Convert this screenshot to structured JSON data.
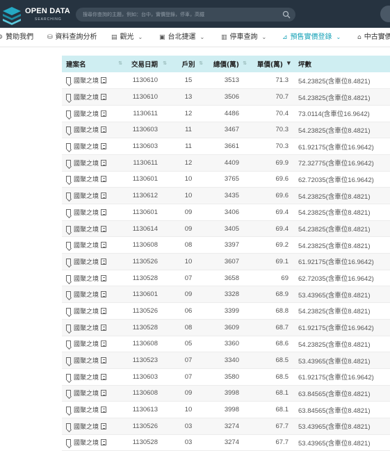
{
  "brand": {
    "line1": "OPEN DATA",
    "line2": "SEARCHING",
    "color": "#263340",
    "accent": "#1aa3b8"
  },
  "search": {
    "placeholder": "搜尋你查詢的主題，例如：台中，實價登錄，停車，高鐵",
    "icon": "search-icon"
  },
  "nav": [
    {
      "label": "贊助我們",
      "icon": "sponsor-icon",
      "dropdown": false
    },
    {
      "label": "資料查詢分析",
      "icon": "database-icon",
      "dropdown": false
    },
    {
      "label": "觀光",
      "icon": "tourism-icon",
      "dropdown": true
    },
    {
      "label": "台北捷運",
      "icon": "train-icon",
      "dropdown": true
    },
    {
      "label": "停車查詢",
      "icon": "parking-icon",
      "dropdown": true
    },
    {
      "label": "預售實價登錄",
      "icon": "presale-icon",
      "dropdown": true,
      "active": true
    },
    {
      "label": "中古實價",
      "icon": "house-icon",
      "dropdown": false
    }
  ],
  "table": {
    "headers": [
      "建案名",
      "交易日期",
      "戶別",
      "總價(萬)",
      "單價(萬)",
      "坪數"
    ],
    "sorted_column": "單價(萬)",
    "rows": [
      {
        "name": "國聚之境",
        "date": "1130610",
        "unit": "15",
        "total": "3513",
        "price": "71.3",
        "area": "54.23825(含車位8.4821)"
      },
      {
        "name": "國聚之境",
        "date": "1130610",
        "unit": "13",
        "total": "3506",
        "price": "70.7",
        "area": "54.23825(含車位8.4821)"
      },
      {
        "name": "國聚之境",
        "date": "1130611",
        "unit": "12",
        "total": "4486",
        "price": "70.4",
        "area": "73.0114(含車位16.9642)"
      },
      {
        "name": "國聚之境",
        "date": "1130603",
        "unit": "11",
        "total": "3467",
        "price": "70.3",
        "area": "54.23825(含車位8.4821)"
      },
      {
        "name": "國聚之境",
        "date": "1130603",
        "unit": "11",
        "total": "3661",
        "price": "70.3",
        "area": "61.92175(含車位16.9642)"
      },
      {
        "name": "國聚之境",
        "date": "1130611",
        "unit": "12",
        "total": "4409",
        "price": "69.9",
        "area": "72.32775(含車位16.9642)"
      },
      {
        "name": "國聚之境",
        "date": "1130601",
        "unit": "10",
        "total": "3765",
        "price": "69.6",
        "area": "62.72035(含車位16.9642)"
      },
      {
        "name": "國聚之境",
        "date": "1130612",
        "unit": "10",
        "total": "3435",
        "price": "69.6",
        "area": "54.23825(含車位8.4821)"
      },
      {
        "name": "國聚之境",
        "date": "1130601",
        "unit": "09",
        "total": "3406",
        "price": "69.4",
        "area": "54.23825(含車位8.4821)"
      },
      {
        "name": "國聚之境",
        "date": "1130614",
        "unit": "09",
        "total": "3405",
        "price": "69.4",
        "area": "54.23825(含車位8.4821)"
      },
      {
        "name": "國聚之境",
        "date": "1130608",
        "unit": "08",
        "total": "3397",
        "price": "69.2",
        "area": "54.23825(含車位8.4821)"
      },
      {
        "name": "國聚之境",
        "date": "1130526",
        "unit": "10",
        "total": "3607",
        "price": "69.1",
        "area": "61.92175(含車位16.9642)"
      },
      {
        "name": "國聚之境",
        "date": "1130528",
        "unit": "07",
        "total": "3658",
        "price": "69",
        "area": "62.72035(含車位16.9642)"
      },
      {
        "name": "國聚之境",
        "date": "1130601",
        "unit": "09",
        "total": "3328",
        "price": "68.9",
        "area": "53.43965(含車位8.4821)"
      },
      {
        "name": "國聚之境",
        "date": "1130526",
        "unit": "06",
        "total": "3399",
        "price": "68.8",
        "area": "54.23825(含車位8.4821)"
      },
      {
        "name": "國聚之境",
        "date": "1130528",
        "unit": "08",
        "total": "3609",
        "price": "68.7",
        "area": "61.92175(含車位16.9642)"
      },
      {
        "name": "國聚之境",
        "date": "1130608",
        "unit": "05",
        "total": "3360",
        "price": "68.6",
        "area": "54.23825(含車位8.4821)"
      },
      {
        "name": "國聚之境",
        "date": "1130523",
        "unit": "07",
        "total": "3340",
        "price": "68.5",
        "area": "53.43965(含車位8.4821)"
      },
      {
        "name": "國聚之境",
        "date": "1130603",
        "unit": "07",
        "total": "3580",
        "price": "68.5",
        "area": "61.92175(含車位16.9642)"
      },
      {
        "name": "國聚之境",
        "date": "1130608",
        "unit": "09",
        "total": "3998",
        "price": "68.1",
        "area": "63.84565(含車位8.4821)"
      },
      {
        "name": "國聚之境",
        "date": "1130613",
        "unit": "10",
        "total": "3998",
        "price": "68.1",
        "area": "63.84565(含車位8.4821)"
      },
      {
        "name": "國聚之境",
        "date": "1130526",
        "unit": "03",
        "total": "3274",
        "price": "67.7",
        "area": "53.43965(含車位8.4821)"
      },
      {
        "name": "國聚之境",
        "date": "1130528",
        "unit": "03",
        "total": "3274",
        "price": "67.7",
        "area": "53.43965(含車位8.4821)"
      }
    ]
  }
}
